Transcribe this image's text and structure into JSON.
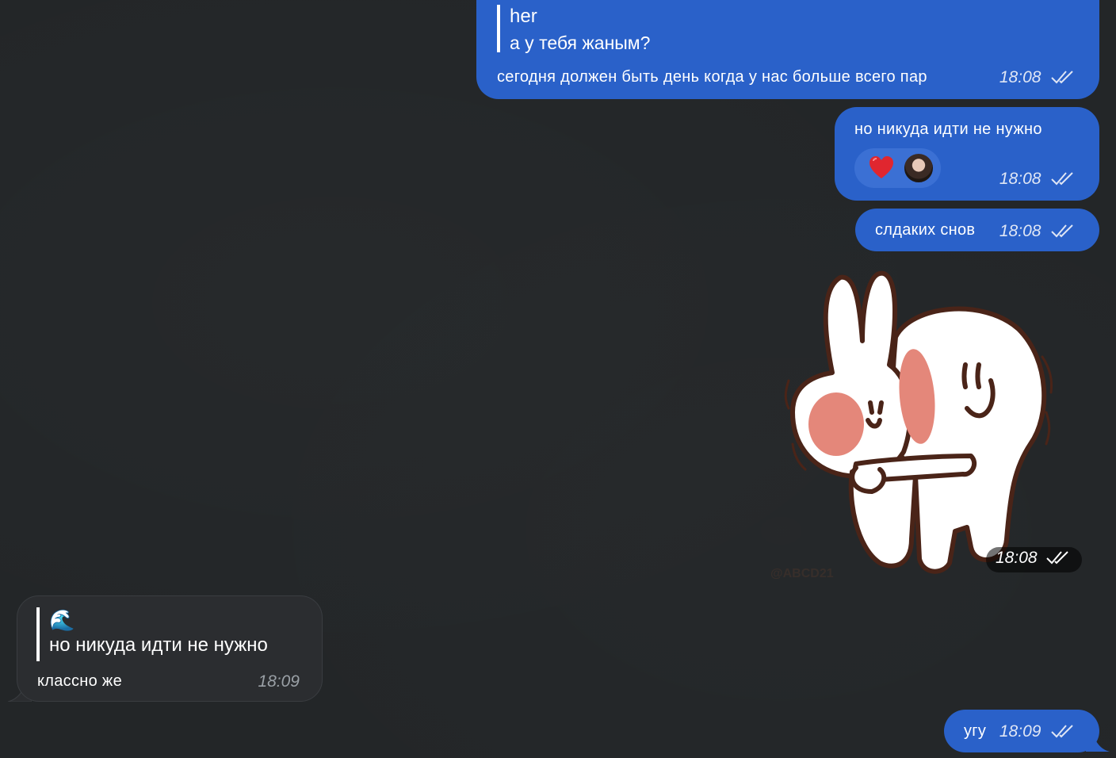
{
  "messages": {
    "m1": {
      "reply_name": "her",
      "reply_text": "а у тебя жаным?",
      "text": "сегодня должен быть день когда у нас больше всего пар",
      "time": "18:08"
    },
    "m2": {
      "text": "но никуда идти не нужно",
      "reaction": "heart",
      "time": "18:08"
    },
    "m3": {
      "text": "слдаких снов",
      "time": "18:08"
    },
    "sticker": {
      "watermark": "@ABCD21",
      "time": "18:08"
    },
    "m4": {
      "reply_emoji": "🌊",
      "reply_text": "но никуда идти не нужно",
      "text": "классно же",
      "time": "18:09"
    },
    "m5": {
      "text": "угу",
      "time": "18:09"
    }
  },
  "colors": {
    "outgoing": "#2a61c9",
    "incoming": "#2b2d30",
    "background": "#232628"
  }
}
